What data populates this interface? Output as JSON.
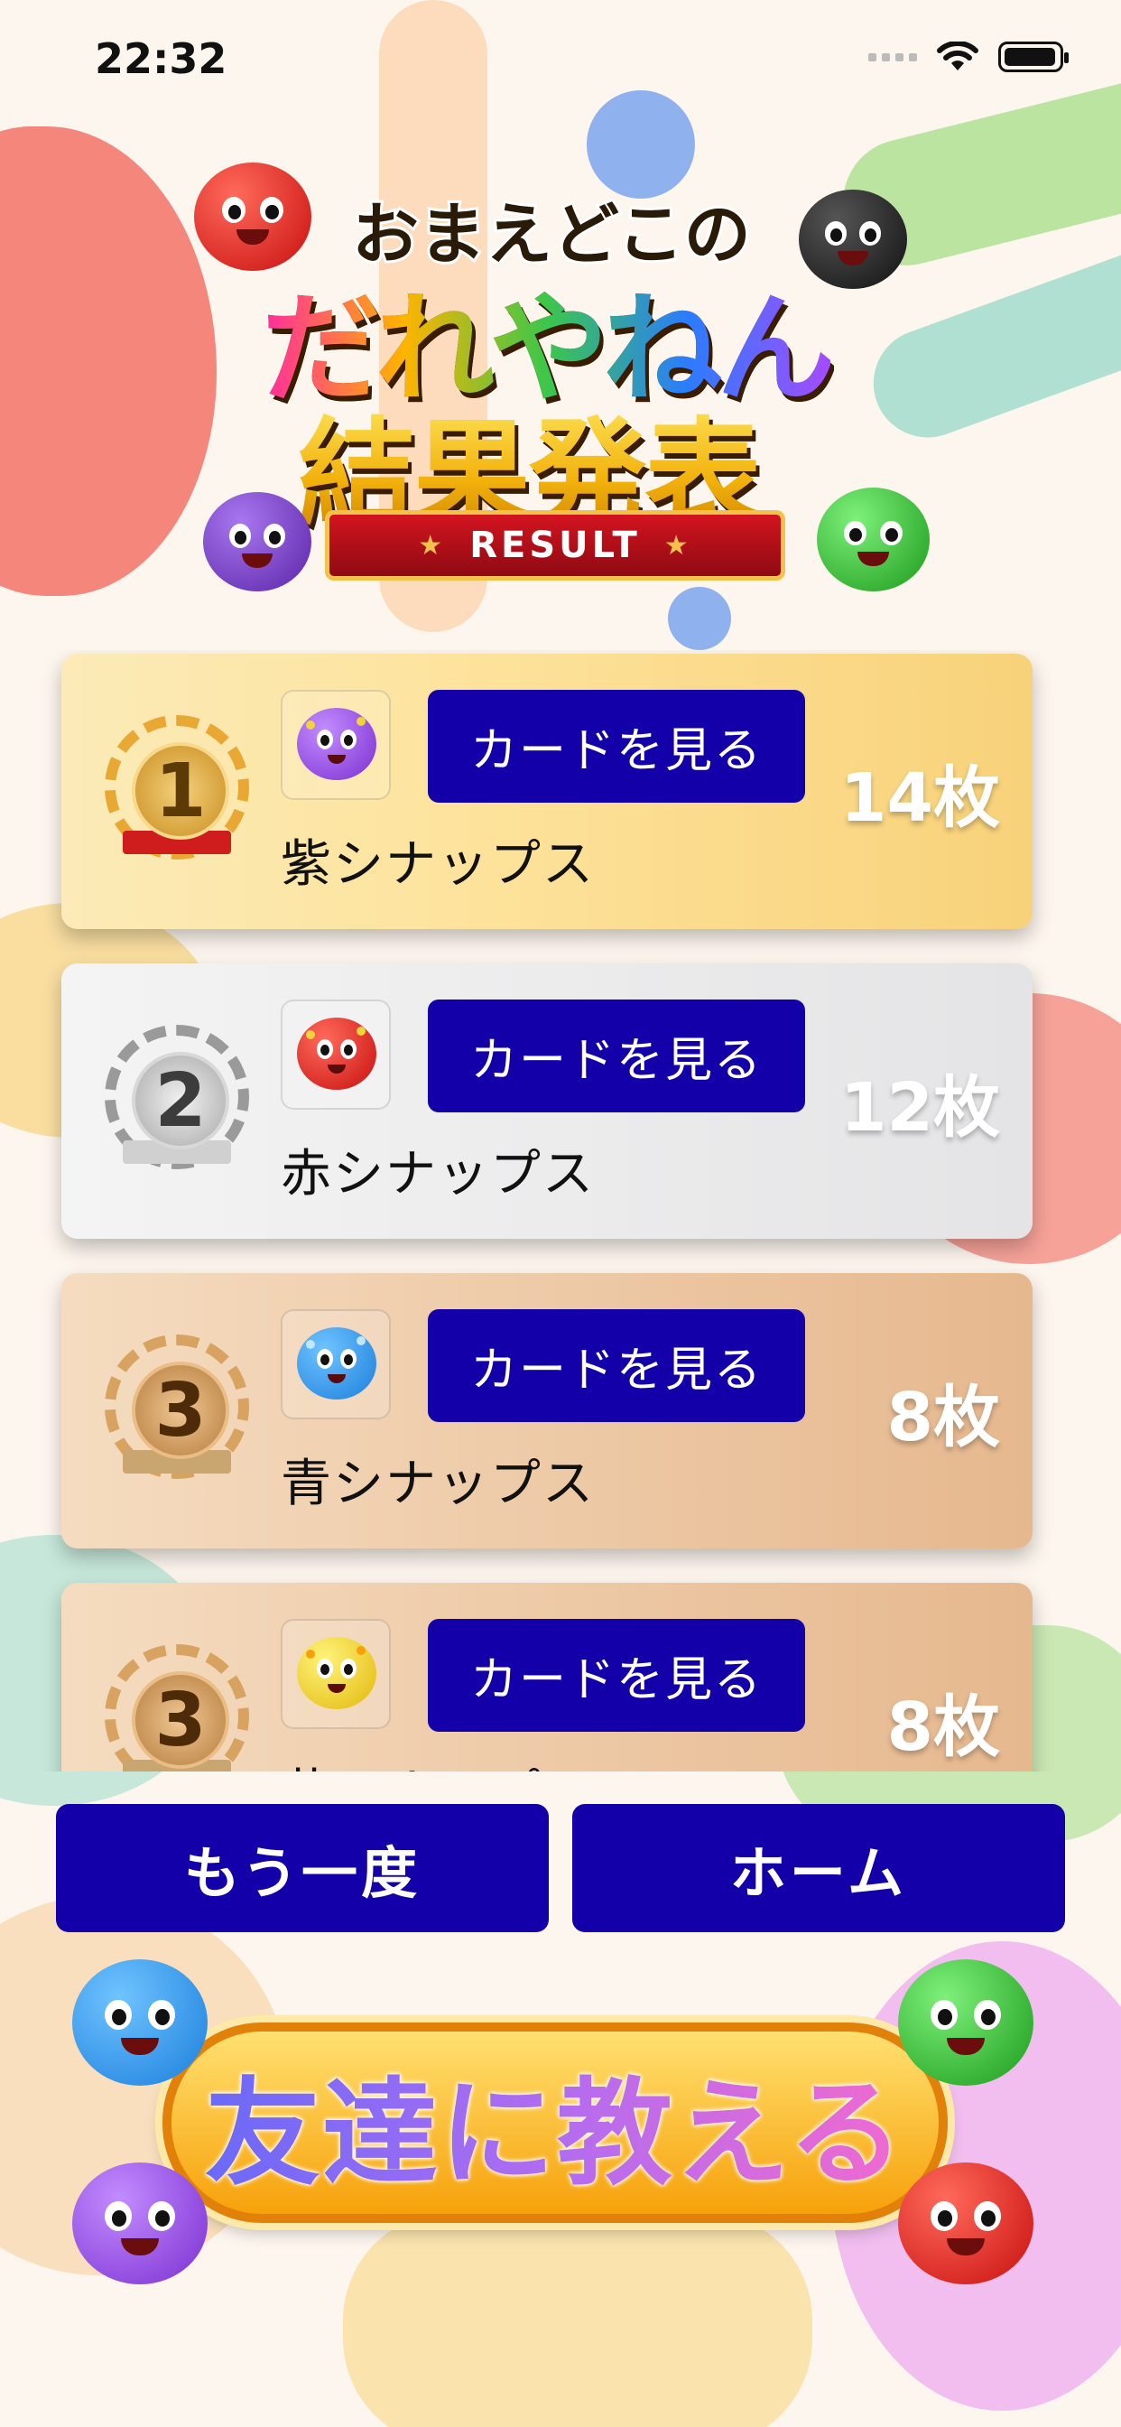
{
  "status_bar": {
    "time": "22:32"
  },
  "logo": {
    "line1": "おまえどこの",
    "line2": "だれやねん",
    "line3": "結果発表",
    "ribbon": "RESULT"
  },
  "results": [
    {
      "rank": "1",
      "name": "紫シナップス",
      "count": "14枚",
      "button": "カードを見る",
      "tier": "gold",
      "creature": "purple-creature-icon",
      "color": "#9b4de0"
    },
    {
      "rank": "2",
      "name": "赤シナップス",
      "count": "12枚",
      "button": "カードを見る",
      "tier": "silver",
      "creature": "red-creature-icon",
      "color": "#e21f1f"
    },
    {
      "rank": "3",
      "name": "青シナップス",
      "count": "8枚",
      "button": "カードを見る",
      "tier": "bronze",
      "creature": "blue-creature-icon",
      "color": "#2b9bf0"
    },
    {
      "rank": "3",
      "name": "黄シナップス",
      "count": "8枚",
      "button": "カードを見る",
      "tier": "bronze",
      "creature": "yellow-creature-icon",
      "color": "#f2d21a"
    }
  ],
  "actions": {
    "retry": "もう一度",
    "home": "ホーム",
    "share": "友達に教える"
  },
  "colors": {
    "button": "#1300a8",
    "background": "#fdf6ee"
  }
}
